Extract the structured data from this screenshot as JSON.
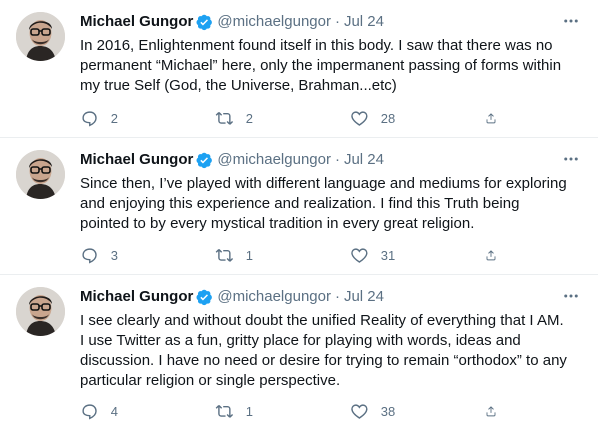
{
  "colors": {
    "verified": "#1da1f2",
    "text": "#0f1419",
    "secondary": "#5b7083",
    "divider": "#ebeef0"
  },
  "tweets": [
    {
      "author": {
        "name": "Michael Gungor",
        "handle": "@michaelgungor",
        "verified": true
      },
      "separator": "·",
      "date": "Jul 24",
      "text": "In 2016, Enlightenment found itself in this body. I saw that there was no permanent “Michael” here, only the impermanent passing of forms within my true Self (God, the Universe, Brahman...etc)",
      "stats": {
        "replies": "2",
        "retweets": "2",
        "likes": "28"
      }
    },
    {
      "author": {
        "name": "Michael Gungor",
        "handle": "@michaelgungor",
        "verified": true
      },
      "separator": "·",
      "date": "Jul 24",
      "text": "Since then, I’ve played with different language and mediums for exploring and enjoying this experience and realization. I find this Truth being pointed to by every mystical tradition in every great religion.",
      "stats": {
        "replies": "3",
        "retweets": "1",
        "likes": "31"
      }
    },
    {
      "author": {
        "name": "Michael Gungor",
        "handle": "@michaelgungor",
        "verified": true
      },
      "separator": "·",
      "date": "Jul 24",
      "text": "I see clearly and without doubt the unified Reality of everything that I AM. I use Twitter as a fun, gritty place for playing with words, ideas and discussion. I have no need or desire for trying to remain “orthodox” to any particular religion or single perspective.",
      "stats": {
        "replies": "4",
        "retweets": "1",
        "likes": "38"
      }
    }
  ],
  "icons": {
    "reply": "reply-icon",
    "retweet": "retweet-icon",
    "like": "like-icon",
    "share": "share-icon",
    "more": "more-options-icon",
    "verified": "verified-badge-icon"
  }
}
